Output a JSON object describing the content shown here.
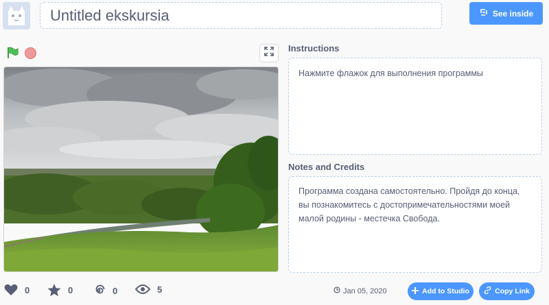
{
  "project": {
    "title": "Untitled ekskursia",
    "see_inside_label": "See inside"
  },
  "instructions": {
    "heading": "Instructions",
    "text": "Нажмите флажок для выполнения программы"
  },
  "notes": {
    "heading": "Notes and Credits",
    "text": "Программа создана самостоятельно. Пройдя до конца, вы познакомитесь с достопримечательностями моей малой родины - местечка Свобода."
  },
  "stats": {
    "loves": "0",
    "favorites": "0",
    "remixes": "0",
    "views": "5"
  },
  "footer": {
    "share_date": "Jan 05, 2020",
    "add_to_studio_label": "Add to Studio",
    "copy_link_label": "Copy Link"
  },
  "colors": {
    "accent": "#4c97ff",
    "flag": "#4cbf56",
    "stop": "#ef9a9a"
  },
  "icons": [
    "cat-avatar-icon",
    "see-inside-icon",
    "green-flag-icon",
    "stop-icon",
    "fullscreen-icon",
    "heart-icon",
    "star-icon",
    "remix-icon",
    "eye-icon",
    "globe-icon",
    "plus-icon",
    "link-icon"
  ]
}
